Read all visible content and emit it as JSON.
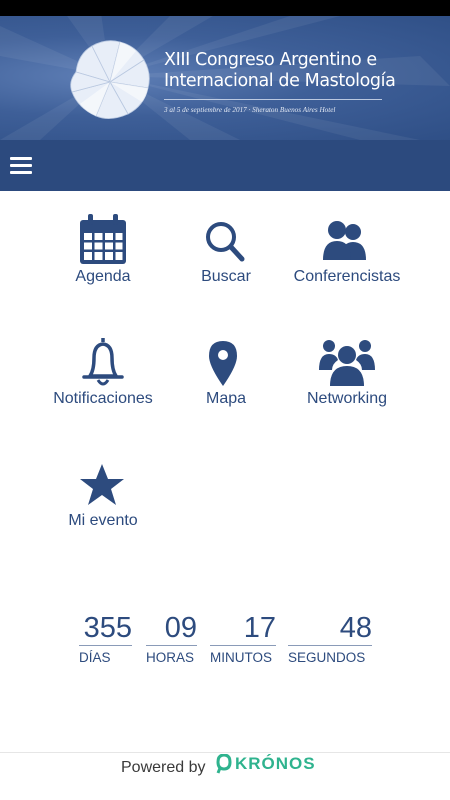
{
  "header": {
    "title_line1": "XIII Congreso Argentino e",
    "title_line2": "Internacional de Mastología",
    "subtitle": "3 al 5 de septiembre de 2017 · Sheraton Buenos Aires Hotel"
  },
  "menu": {
    "items": [
      {
        "label": "Agenda",
        "icon": "calendar-icon"
      },
      {
        "label": "Buscar",
        "icon": "search-icon"
      },
      {
        "label": "Conferencistas",
        "icon": "speakers-icon"
      },
      {
        "label": "Notificaciones",
        "icon": "bell-icon"
      },
      {
        "label": "Mapa",
        "icon": "map-pin-icon"
      },
      {
        "label": "Networking",
        "icon": "group-icon"
      },
      {
        "label": "Mi evento",
        "icon": "star-icon"
      }
    ]
  },
  "countdown": {
    "days": "355",
    "days_label": "DÍAS",
    "hours": "09",
    "hours_label": "HORAS",
    "minutes": "17",
    "minutes_label": "MINUTOS",
    "seconds": "48",
    "seconds_label": "SEGUNDOS"
  },
  "footer": {
    "powered_by": "Powered by",
    "brand": "KRÓNOS"
  },
  "colors": {
    "primary": "#2c4a7e",
    "banner": "#3e5f98",
    "brand": "#2fb38e"
  }
}
